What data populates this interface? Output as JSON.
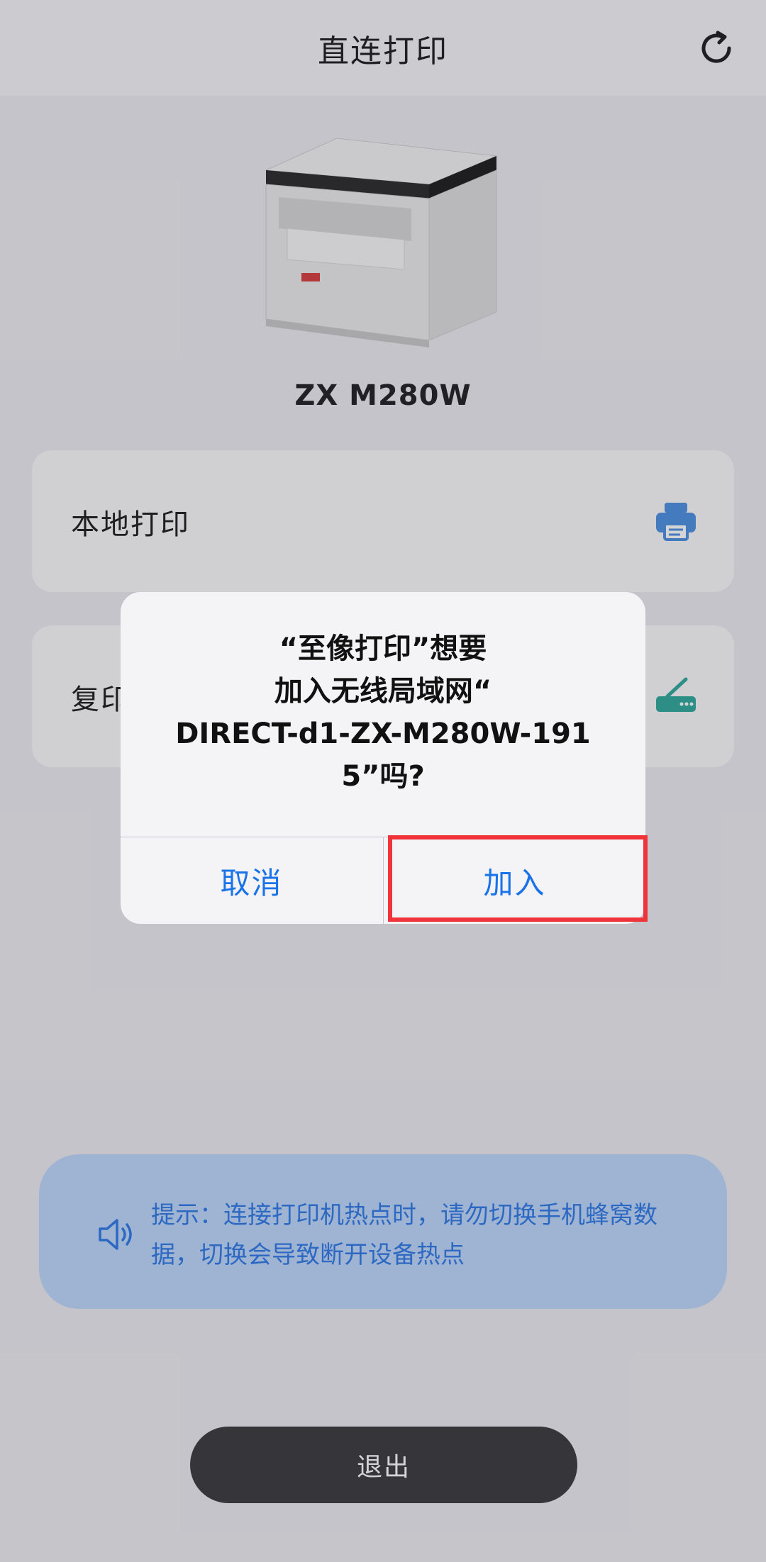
{
  "header": {
    "title": "直连打印"
  },
  "printer": {
    "model": "ZX M280W"
  },
  "options": [
    {
      "label": "本地打印",
      "icon": "printer-icon"
    },
    {
      "label": "复印",
      "icon": "scanner-icon"
    }
  ],
  "notice": {
    "text": "提示：连接打印机热点时，请勿切换手机蜂窝数据，切换会导致断开设备热点",
    "icon": "speaker-icon"
  },
  "exit_button": {
    "label": "退出"
  },
  "dialog": {
    "line1": "“至像打印”想要",
    "line2": "加入无线局域网“",
    "line3": "DIRECT-d1-ZX-M280W-191",
    "line4": "5”吗?",
    "cancel_label": "取消",
    "join_label": "加入"
  },
  "colors": {
    "accent": "#1a73e8",
    "highlight": "#f0323a",
    "notice_bg": "#bcd8fb",
    "notice_text": "#2f7ae6"
  }
}
